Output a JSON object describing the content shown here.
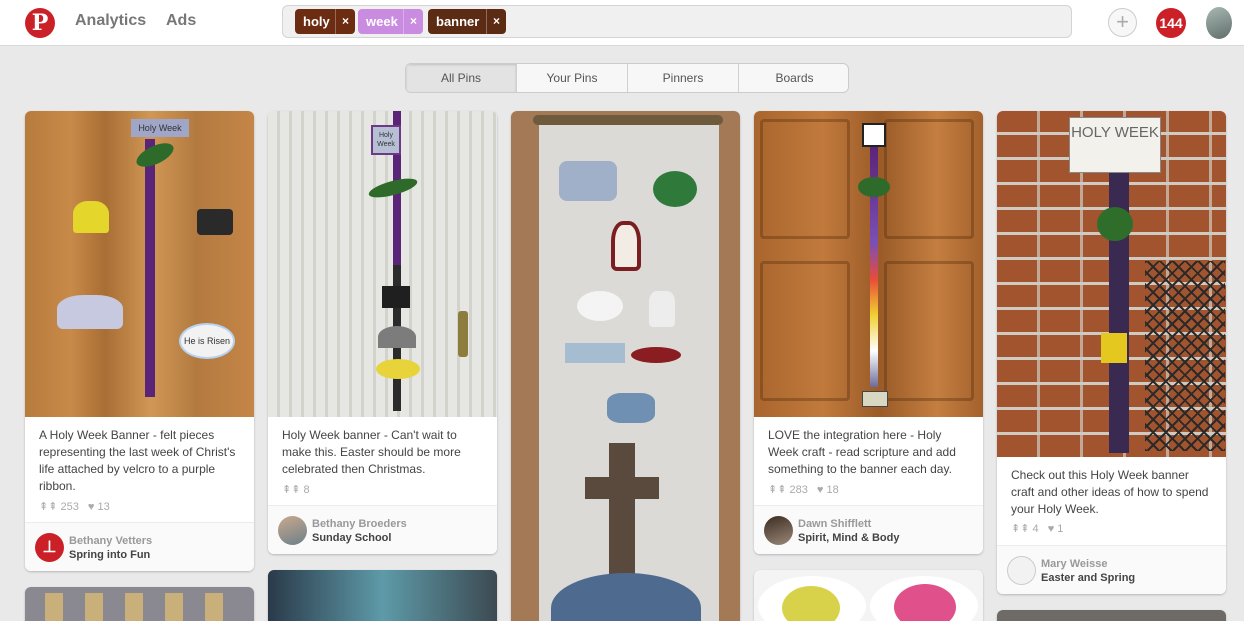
{
  "header": {
    "logo": "P",
    "nav": [
      "Analytics",
      "Ads"
    ],
    "search_tags": [
      {
        "label": "holy",
        "color": "#6b2c12"
      },
      {
        "label": "week",
        "color": "#c98ce0"
      },
      {
        "label": "banner",
        "color": "#5c2b13"
      }
    ],
    "tag_close": "×",
    "add": "+",
    "notifications": "144"
  },
  "tabs": [
    "All Pins",
    "Your Pins",
    "Pinners",
    "Boards"
  ],
  "pins": [
    {
      "description": "A Holy Week Banner - felt pieces representing the last week of Christ's life attached by velcro to a purple ribbon.",
      "repins": "253",
      "likes": "13",
      "pinner": "Bethany Vetters",
      "board": "Spring into Fun",
      "sign": "Holy Week",
      "sign2": "He is Risen"
    },
    {
      "description": "Holy Week banner - Can't wait to make this. Easter should be more celebrated then Christmas.",
      "repins": "8",
      "pinner": "Bethany Broeders",
      "board": "Sunday School",
      "sign": "Holy Week"
    },
    {
      "description": "LOVE the integration here - Holy Week craft - read scripture and add something to the banner each day.",
      "repins": "283",
      "likes": "18",
      "pinner": "Dawn Shifflett",
      "board": "Spirit, Mind & Body"
    },
    {
      "description": "Check out this Holy Week banner craft and other ideas of how to spend your Holy Week.",
      "repins": "4",
      "likes": "1",
      "pinner": "Mary Weisse",
      "board": "Easter and Spring",
      "sign": "HOLY WEEK"
    }
  ],
  "icons": {
    "repin": "repin-icon",
    "like": "heart-icon",
    "pin": "pushpin-icon"
  },
  "colors": {
    "brand": "#cb2027"
  }
}
